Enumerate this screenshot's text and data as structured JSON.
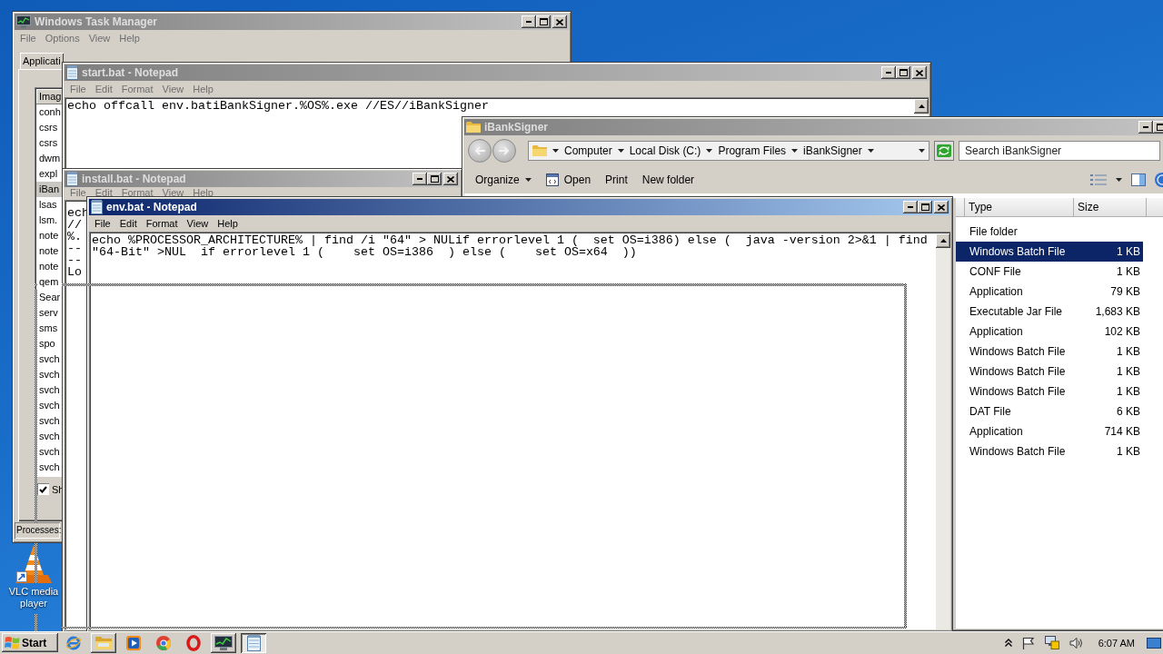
{
  "desktop": {
    "icons": [
      {
        "label": "VLC media player"
      }
    ]
  },
  "windows": [
    {
      "kind": "task_manager",
      "title": "Windows Task Manager",
      "active": false,
      "menu": [
        "File",
        "Options",
        "View",
        "Help"
      ],
      "tabs": [
        {
          "label": "Applicati",
          "selected": false
        }
      ],
      "column": "Imag",
      "processes": [
        {
          "name": "conh",
          "selected": false
        },
        {
          "name": "csrs",
          "selected": false
        },
        {
          "name": "csrs",
          "selected": false
        },
        {
          "name": "dwm",
          "selected": false
        },
        {
          "name": "expl",
          "selected": false
        },
        {
          "name": "iBan",
          "selected": true
        },
        {
          "name": "lsas",
          "selected": false
        },
        {
          "name": "lsm.",
          "selected": false
        },
        {
          "name": "note",
          "selected": false
        },
        {
          "name": "note",
          "selected": false
        },
        {
          "name": "note",
          "selected": false
        },
        {
          "name": "qem",
          "selected": false
        },
        {
          "name": "Sear",
          "selected": false
        },
        {
          "name": "serv",
          "selected": false
        },
        {
          "name": "sms",
          "selected": false
        },
        {
          "name": "spo",
          "selected": false
        },
        {
          "name": "svch",
          "selected": false
        },
        {
          "name": "svch",
          "selected": false
        },
        {
          "name": "svch",
          "selected": false
        },
        {
          "name": "svch",
          "selected": false
        },
        {
          "name": "svch",
          "selected": false
        },
        {
          "name": "svch",
          "selected": false
        },
        {
          "name": "svch",
          "selected": false
        },
        {
          "name": "svch",
          "selected": false
        }
      ],
      "show_all": {
        "label": "Sh",
        "checked": true
      },
      "status": "Processes:"
    },
    {
      "kind": "notepad",
      "title": "start.bat - Notepad",
      "active": false,
      "menu": [
        "File",
        "Edit",
        "Format",
        "View",
        "Help"
      ],
      "lines": [
        "echo offcall env.batiBankSigner.%OS%.exe //ES//iBankSigner"
      ]
    },
    {
      "kind": "explorer",
      "title": "iBankSigner",
      "active": false,
      "breadcrumb": [
        "Computer",
        "Local Disk (C:)",
        "Program Files",
        "iBankSigner"
      ],
      "search": {
        "placeholder": "Search iBankSigner"
      },
      "toolbar": [
        {
          "label": "Organize",
          "kind": "menu"
        },
        {
          "label": "Open",
          "kind": "icon"
        },
        {
          "label": "Print",
          "kind": "plain"
        },
        {
          "label": "New folder",
          "kind": "plain"
        }
      ],
      "columns": [
        "Type",
        "Size"
      ],
      "rows": [
        {
          "type": "File folder",
          "selected": false
        },
        {
          "type": "Windows Batch File",
          "size": "1 KB",
          "selected": true
        },
        {
          "type": "CONF File",
          "size": "1 KB",
          "selected": false
        },
        {
          "type": "Application",
          "size": "79 KB",
          "selected": false
        },
        {
          "type": "Executable Jar File",
          "size": "1,683 KB",
          "selected": false
        },
        {
          "type": "Application",
          "size": "102 KB",
          "selected": false
        },
        {
          "type": "Windows Batch File",
          "size": "1 KB",
          "selected": false
        },
        {
          "type": "Windows Batch File",
          "size": "1 KB",
          "selected": false
        },
        {
          "type": "Windows Batch File",
          "size": "1 KB",
          "selected": false
        },
        {
          "type": "DAT File",
          "size": "6 KB",
          "selected": false
        },
        {
          "type": "Application",
          "size": "714 KB",
          "selected": false
        },
        {
          "type": "Windows Batch File",
          "size": "1 KB",
          "selected": false
        }
      ]
    },
    {
      "kind": "notepad",
      "title": "install.bat - Notepad",
      "active": false,
      "menu": [
        "File",
        "Edit",
        "Format",
        "View",
        "Help"
      ],
      "lines": [
        "ech",
        "//",
        "%.",
        "--",
        "--",
        "Lo"
      ]
    },
    {
      "kind": "notepad",
      "title": "env.bat - Notepad",
      "active": true,
      "menu": [
        "File",
        "Edit",
        "Format",
        "View",
        "Help"
      ],
      "lines": [
        "echo %PROCESSOR_ARCHITECTURE% | find /i \"64\" > NULif errorlevel 1 (  set OS=i386) else (  java -version 2>&1 | find",
        "\"64-Bit\" >NUL  if errorlevel 1 (    set OS=i386  ) else (    set OS=x64  ))"
      ]
    }
  ],
  "taskbar": {
    "start": "Start",
    "apps": [
      {
        "kind": "browser_e",
        "running": false,
        "selected": false
      },
      {
        "kind": "folder",
        "running": true,
        "selected": false
      },
      {
        "kind": "media_player",
        "running": false,
        "selected": false
      },
      {
        "kind": "browser_round",
        "running": false,
        "selected": false
      },
      {
        "kind": "browser_o",
        "running": false,
        "selected": false
      },
      {
        "kind": "task_manager",
        "running": true,
        "selected": false
      },
      {
        "kind": "notepad",
        "running": true,
        "selected": true
      }
    ],
    "clock": "6:07 AM"
  }
}
